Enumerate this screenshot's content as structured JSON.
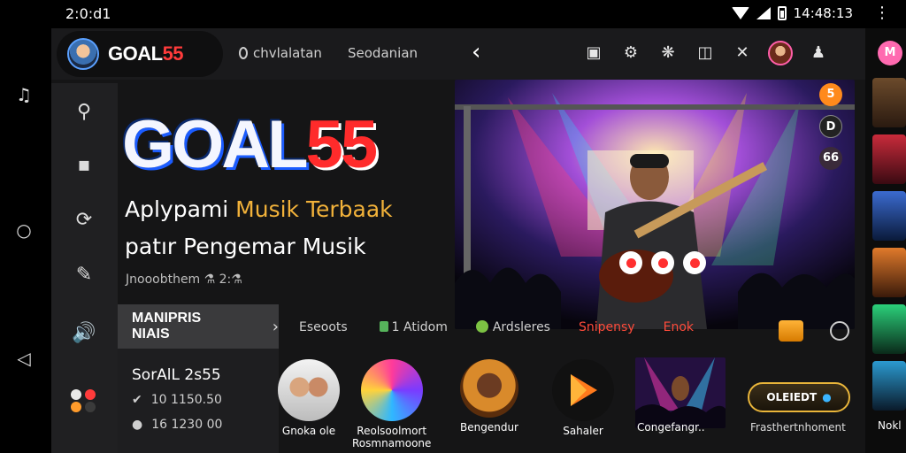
{
  "status_bar": {
    "time": "2:0:d1",
    "clock_right": "14:48:13"
  },
  "app": {
    "logo_part1": "GOAL",
    "logo_part2": "55",
    "nav_links": [
      "chvlalatan",
      "Seodanian"
    ]
  },
  "hero": {
    "title_part1": "GOAL",
    "title_part2": "55",
    "subtitle_line1_a": "Aplypami ",
    "subtitle_line1_b": "Musik Terbaak",
    "subtitle_line2": "patır Pengemar Musik",
    "meta": "Jnooobthem ⚗ 2:⚗"
  },
  "float_buttons": [
    "5",
    "D",
    "66"
  ],
  "manage": {
    "label": "MANIPRIS NIAIS",
    "chevron": "›"
  },
  "info_card": {
    "title": "SorAlL 2s55",
    "line1": "10 1150.50",
    "line2": "16 1230 00"
  },
  "tabs": [
    {
      "label": "Eseoots"
    },
    {
      "label": "1   Atidom"
    },
    {
      "label": "Ardsleres"
    },
    {
      "label": "Snipensy"
    },
    {
      "label": "Enok"
    }
  ],
  "tiles": {
    "t1_label": "Gnoka ole",
    "t2_label1": "Reolsoolmort",
    "t2_label2": "Rosmnamoone",
    "t3_label": "Bengendur",
    "t4_label": "Sahaler",
    "t5_label": "Congefangr..",
    "pill_label": "OLEIEDT",
    "pill_caption": "Frasthertnhoment"
  },
  "right_strip": {
    "top_icon": "M",
    "bottom_label": "Nokl"
  },
  "colors": {
    "accent_red": "#ff2b2b",
    "accent_gold": "#f2b23a",
    "bg": "#151516"
  }
}
